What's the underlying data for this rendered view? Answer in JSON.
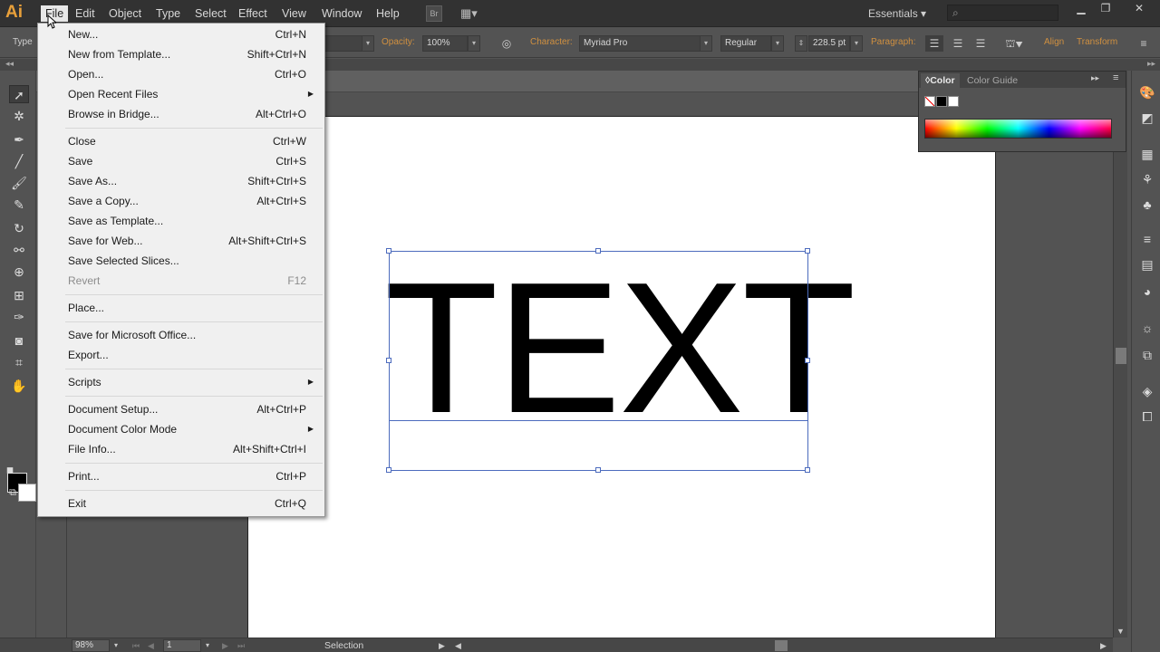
{
  "app": {
    "logo": "Ai"
  },
  "menubar": {
    "items": [
      "File",
      "Edit",
      "Object",
      "Type",
      "Select",
      "Effect",
      "View",
      "Window",
      "Help"
    ],
    "bridge_label": "Br",
    "workspace": "Essentials",
    "search_placeholder": ""
  },
  "controlbar": {
    "tool_label": "Type",
    "opacity_label": "Opacity:",
    "opacity_value": "100%",
    "character_label": "Character:",
    "font_family": "Myriad Pro",
    "font_style": "Regular",
    "font_size": "228.5 pt",
    "paragraph_label": "Paragraph:",
    "align_label": "Align",
    "transform_label": "Transform"
  },
  "file_menu": {
    "items": [
      {
        "label": "New...",
        "shortcut": "Ctrl+N"
      },
      {
        "label": "New from Template...",
        "shortcut": "Shift+Ctrl+N"
      },
      {
        "label": "Open...",
        "shortcut": "Ctrl+O"
      },
      {
        "label": "Open Recent Files",
        "shortcut": "",
        "submenu": true
      },
      {
        "label": "Browse in Bridge...",
        "shortcut": "Alt+Ctrl+O"
      },
      {
        "label": "Close",
        "shortcut": "Ctrl+W"
      },
      {
        "label": "Save",
        "shortcut": "Ctrl+S"
      },
      {
        "label": "Save As...",
        "shortcut": "Shift+Ctrl+S"
      },
      {
        "label": "Save a Copy...",
        "shortcut": "Alt+Ctrl+S"
      },
      {
        "label": "Save as Template...",
        "shortcut": ""
      },
      {
        "label": "Save for Web...",
        "shortcut": "Alt+Shift+Ctrl+S"
      },
      {
        "label": "Save Selected Slices...",
        "shortcut": ""
      },
      {
        "label": "Revert",
        "shortcut": "F12",
        "disabled": true
      },
      {
        "label": "Place...",
        "shortcut": ""
      },
      {
        "label": "Save for Microsoft Office...",
        "shortcut": ""
      },
      {
        "label": "Export...",
        "shortcut": ""
      },
      {
        "label": "Scripts",
        "shortcut": "",
        "submenu": true
      },
      {
        "label": "Document Setup...",
        "shortcut": "Alt+Ctrl+P"
      },
      {
        "label": "Document Color Mode",
        "shortcut": "",
        "submenu": true
      },
      {
        "label": "File Info...",
        "shortcut": "Alt+Shift+Ctrl+I"
      },
      {
        "label": "Print...",
        "shortcut": "Ctrl+P"
      },
      {
        "label": "Exit",
        "shortcut": "Ctrl+Q"
      }
    ]
  },
  "color_panel": {
    "tabs": [
      "Color",
      "Color Guide"
    ]
  },
  "artboard": {
    "text": "TEXT"
  },
  "statusbar": {
    "zoom": "98%",
    "artboard_number": "1",
    "status": "Selection"
  },
  "colors": {
    "menu_bg": "#f0f0f0",
    "chrome_dark": "#323232",
    "panel_bg": "#535353",
    "selection_blue": "#4c6bbd",
    "accent_orange": "#d09040"
  },
  "icons": [
    "arrow-cursor-icon",
    "search-icon",
    "minimize-icon",
    "restore-icon",
    "close-icon",
    "submenu-arrow-icon",
    "selection-tool-icon",
    "magic-wand-icon",
    "pen-tool-icon",
    "line-tool-icon",
    "brush-icon",
    "rotate-icon",
    "eyedropper-icon",
    "hand-icon",
    "zoom-icon"
  ]
}
